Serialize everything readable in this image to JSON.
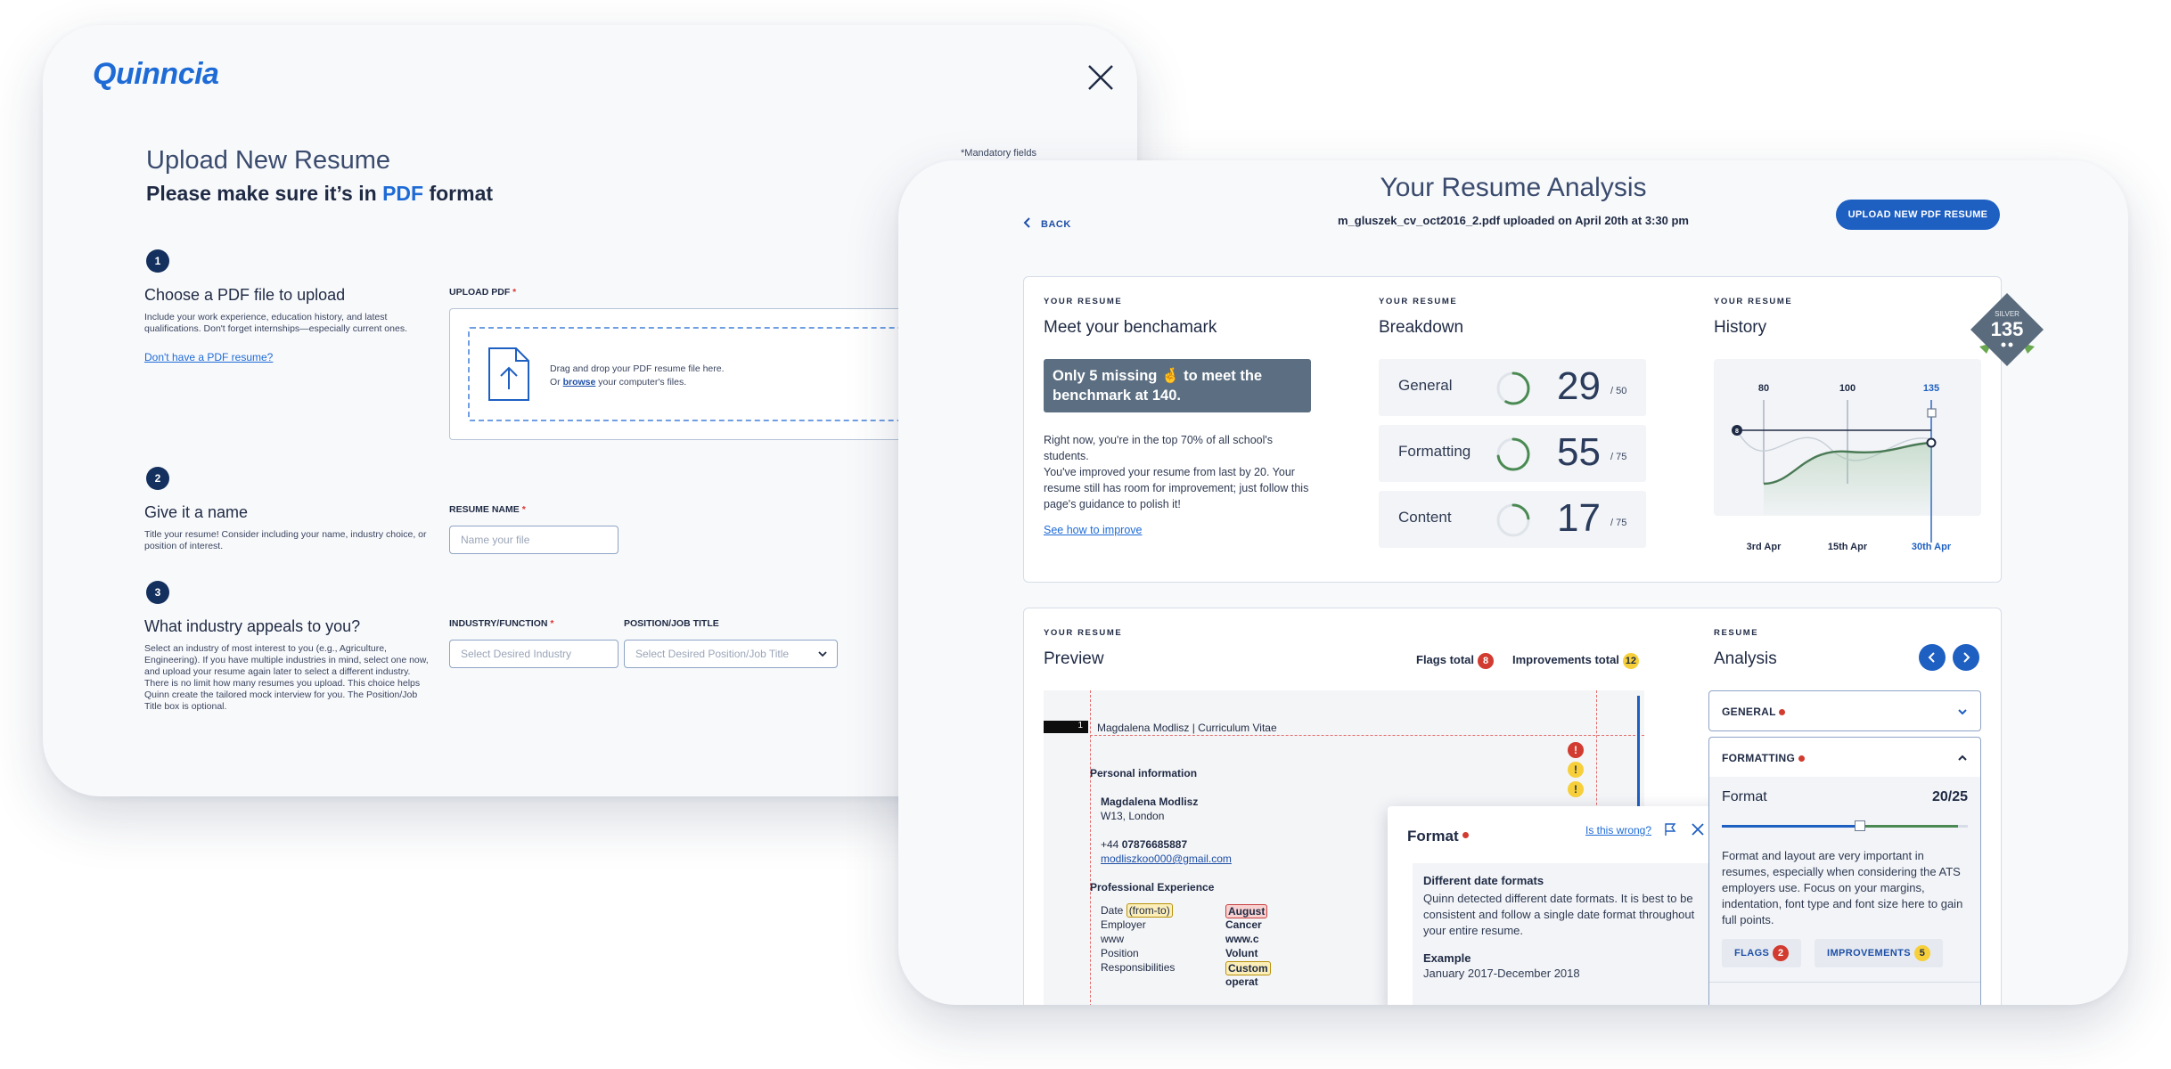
{
  "upload": {
    "logo": "Quinncia",
    "mandatory_note": "*Mandatory fields",
    "title": "Upload New Resume",
    "subtitle_pre": "Please make sure it’s in ",
    "subtitle_pdf": "PDF",
    "subtitle_post": " format",
    "steps": [
      {
        "num": "1",
        "title": "Choose a PDF file to upload",
        "desc": "Include your work experience, education history, and latest qualifications. Don't forget internships—especially current ones.",
        "link": "Don't have a PDF resume?"
      },
      {
        "num": "2",
        "title": "Give it a name",
        "desc": "Title your resume! Consider including your name, industry choice, or position of interest."
      },
      {
        "num": "3",
        "title": "What industry appeals to you?",
        "desc": "Select an industry of most interest to you (e.g., Agriculture, Engineering). If you have multiple industries in mind, select one now, and upload your resume again later to select a different industry. There is no limit how many resumes you upload. This choice helps Quinn create the tailored mock interview for you. The Position/Job Title box is optional."
      }
    ],
    "upload_label": "UPLOAD PDF",
    "drop_text_1": "Drag and drop your PDF resume file here.",
    "drop_or": "Or ",
    "drop_browse": "browse",
    "drop_text_2": " your computer's files.",
    "name_label": "RESUME NAME",
    "name_placeholder": "Name your file",
    "industry_label": "INDUSTRY/FUNCTION",
    "industry_placeholder": "Select Desired Industry",
    "position_label": "POSITION/JOB TITLE",
    "position_placeholder": "Select Desired Position/Job Title",
    "required_mark": "*"
  },
  "analysis": {
    "title": "Your Resume Analysis",
    "file_line": "m_gluszek_cv_oct2016_2.pdf uploaded on April 20th at 3:30 pm",
    "back": "BACK",
    "upload_button": "UPLOAD NEW PDF RESUME",
    "eyebrow": "YOUR RESUME",
    "benchmark": {
      "title": "Meet your benchamark",
      "highlight": "Only 5 missing 🤞 to meet the benchmark at 140.",
      "text_1": "Right now, you're in the top 70% of all school's students.",
      "text_2": "You've improved your resume from last by 20. Your resume still has room for improvement; just follow this page's guidance to polish it!",
      "link": "See how to improve"
    },
    "breakdown": {
      "title": "Breakdown",
      "rows": [
        {
          "label": "General",
          "score": "29",
          "total": "/ 50",
          "fraction": 0.58
        },
        {
          "label": "Formatting",
          "score": "55",
          "total": "/ 75",
          "fraction": 0.73
        },
        {
          "label": "Content",
          "score": "17",
          "total": "/ 75",
          "fraction": 0.23
        }
      ]
    },
    "history": {
      "title": "History",
      "badge_label": "SILVER",
      "badge_score": "135",
      "start_value": "8",
      "points": [
        {
          "value": "80",
          "date": "3rd Apr"
        },
        {
          "value": "100",
          "date": "15th Apr"
        },
        {
          "value": "135",
          "date": "30th Apr"
        }
      ]
    },
    "preview": {
      "title": "Preview",
      "flags_label": "Flags total",
      "flags_count": "8",
      "improvements_label": "Improvements total",
      "improvements_count": "12",
      "page_num": "1",
      "doc_header": "Magdalena Modlisz | Curriculum Vitae",
      "personal_info": "Personal information",
      "name": "Magdalena Modlisz",
      "address": "W13, London",
      "phone_pre": "+44 ",
      "phone": "07876685887",
      "email": "modliszkoo000@gmail.com",
      "professional": "Professional Experience",
      "date_label": "Date ",
      "date_hl": "(from-to)",
      "employer": "Employer",
      "www": "www",
      "position": "Position",
      "responsibilities": "Responsibilities",
      "col2": [
        "August",
        "Cancer",
        "www.c",
        "Volunt",
        "Custom",
        "operat"
      ]
    },
    "popup": {
      "title": "Format",
      "link": "Is this wrong?",
      "heading": "Different date formats",
      "body": "Quinn detected different date formats. It is best to be consistent and follow a single date format throughout your entire resume.",
      "example_label": "Example",
      "example": "January 2017-December 2018"
    },
    "side": {
      "eyebrow": "RESUME",
      "title": "Analysis",
      "general": "GENERAL",
      "formatting": "FORMATTING",
      "format_label": "Format",
      "format_score": "20/25",
      "format_fraction": 0.8,
      "format_desc": "Format and layout are very important in resumes, especially when considering the ATS employers use. Focus on your margins, indentation, font type and font size here to gain full points.",
      "flags": "FLAGS",
      "flags_count": "2",
      "improvements": "IMPROVEMENTS",
      "improvements_count": "5"
    }
  }
}
